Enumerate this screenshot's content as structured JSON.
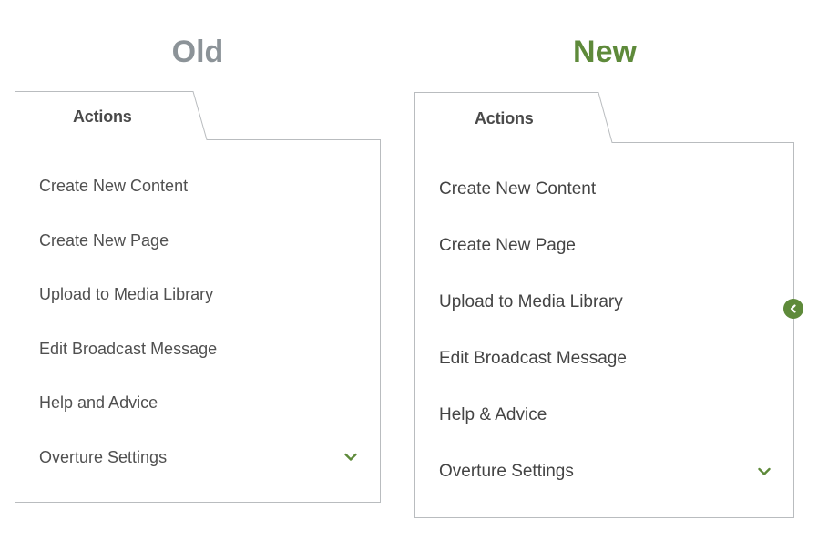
{
  "headings": {
    "old": "Old",
    "new": "New"
  },
  "old_panel": {
    "tab_label": "Actions",
    "items": [
      {
        "label": "Create New Content"
      },
      {
        "label": "Create New Page"
      },
      {
        "label": "Upload to Media Library"
      },
      {
        "label": "Edit Broadcast Message"
      },
      {
        "label": "Help and Advice"
      },
      {
        "label": "Overture Settings",
        "icon": "chevron-down-icon"
      }
    ]
  },
  "new_panel": {
    "tab_label": "Actions",
    "items": [
      {
        "label": "Create New Content"
      },
      {
        "label": "Create New Page"
      },
      {
        "label": "Upload to Media Library"
      },
      {
        "label": "Edit Broadcast Message"
      },
      {
        "label": "Help & Advice"
      },
      {
        "label": "Overture Settings",
        "icon": "chevron-down-icon"
      }
    ],
    "side_toggle_icon": "chevron-left-icon"
  },
  "colors": {
    "old_heading": "#8c9398",
    "new_heading": "#5e8a3a",
    "accent": "#5e8a3a",
    "border": "#b9bcbf",
    "text": "#505050"
  }
}
